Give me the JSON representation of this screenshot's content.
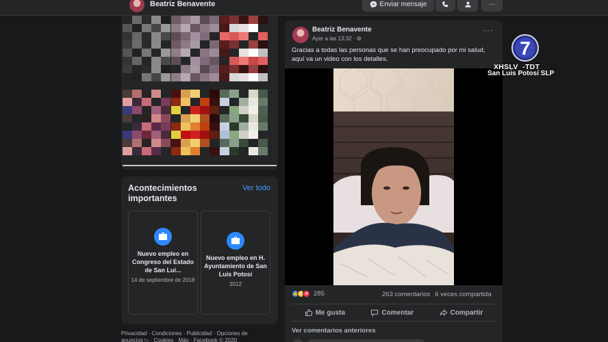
{
  "header": {
    "profile_name": "Beatriz Benavente",
    "message_button": "Enviar mensaje",
    "more_label": "···"
  },
  "photos": {
    "tiles": [
      [
        "#3a3a3a",
        "#6b6b6b",
        "#2b2b2b",
        "#8a8a8a",
        "#1f1f1f",
        "#555",
        "#222",
        "#777",
        "#444",
        "#999",
        "#333",
        "#666",
        "#2a2a2a",
        "#888",
        "#4a4a4a"
      ],
      [
        "#6e5a63",
        "#8d7a86",
        "#a59aa3",
        "#5a4a55",
        "#7c6874",
        "#907d8a",
        "#b5a8b2",
        "#6a5662",
        "#8a7683",
        "#9e8b98",
        "#5e4d58",
        "#7a6672",
        "#a290a0",
        "#806c78",
        "#695562"
      ],
      [
        "#5a1c1c",
        "#7a3030",
        "#3a1414",
        "#9a4040",
        "#2a1010",
        "#4a1818",
        "#d8d8d8",
        "#e8e0e0",
        "#ffffff",
        "#c0c0c0",
        "#e86868",
        "#d85858",
        "#f07878",
        "#c84848",
        "#e06060"
      ],
      [
        "#4a3a3a",
        "#b07070",
        "#2a2222",
        "#d08a8a",
        "#8a4a5a",
        "#e0a0a0",
        "#3a2a3a",
        "#c86a7a",
        "#5a2a4a",
        "#7a3a5a",
        "#3a3a7a",
        "#8a4a6a",
        "#6a2a3a",
        "#a0607a",
        "#4a2a3a"
      ],
      [
        "#4a1010",
        "#d8a050",
        "#f0d070",
        "#b05020",
        "#2a0a0a",
        "#8a2a10",
        "#f0c060",
        "#e08030",
        "#c04010",
        "#3a1010",
        "#e0d040",
        "#c01010",
        "#d02020",
        "#a01010",
        "#602010"
      ],
      [
        "#5a6a5a",
        "#8aa08a",
        "#3a4a3a",
        "#d8d8c8",
        "#4a5a4a",
        "#c8d0e0",
        "#2a3a2a",
        "#a0b0a0",
        "#e8e8e0",
        "#6a7a6a",
        "#b0c0d8",
        "#8aa880",
        "#d0d0c8",
        "#f0f0e8",
        "#506050"
      ]
    ]
  },
  "events": {
    "title": "Acontecimientos importantes",
    "see_all": "Ver todo",
    "items": [
      {
        "title": "Nuevo empleo en Congreso del Estado de San Lui...",
        "date": "14 de septiembre de 2018"
      },
      {
        "title": "Nuevo empleo en H. Ayuntamiento de San Luis Potosí",
        "date": "2012"
      }
    ]
  },
  "footer": {
    "links": "Privacidad · Condiciones · Publicidad · Opciones de anuncios ▷ · Cookies · Más · Facebook © 2020"
  },
  "post": {
    "author": "Beatriz Benavente",
    "time": "Ayer a las 13:32 · ",
    "more": "···",
    "text": "Gracias a todas las personas que se han preocupado por mi salud, aquí va un video con los detalles.",
    "reaction_count": "285",
    "comments": "263 comentarios",
    "shares": "6 veces compartida",
    "actions": {
      "like": "Me gusta",
      "comment": "Comentar",
      "share": "Compartir"
    },
    "previous_comments": "Ver comentarios anteriores"
  },
  "overlay": {
    "logo_number": "7",
    "call_sign": "XHSLV  -TDT",
    "city": "San Luis Potosí SLP"
  },
  "colors": {
    "background": "#18191a",
    "card": "#242526",
    "accent": "#2d88ff",
    "link": "#4599ff"
  }
}
